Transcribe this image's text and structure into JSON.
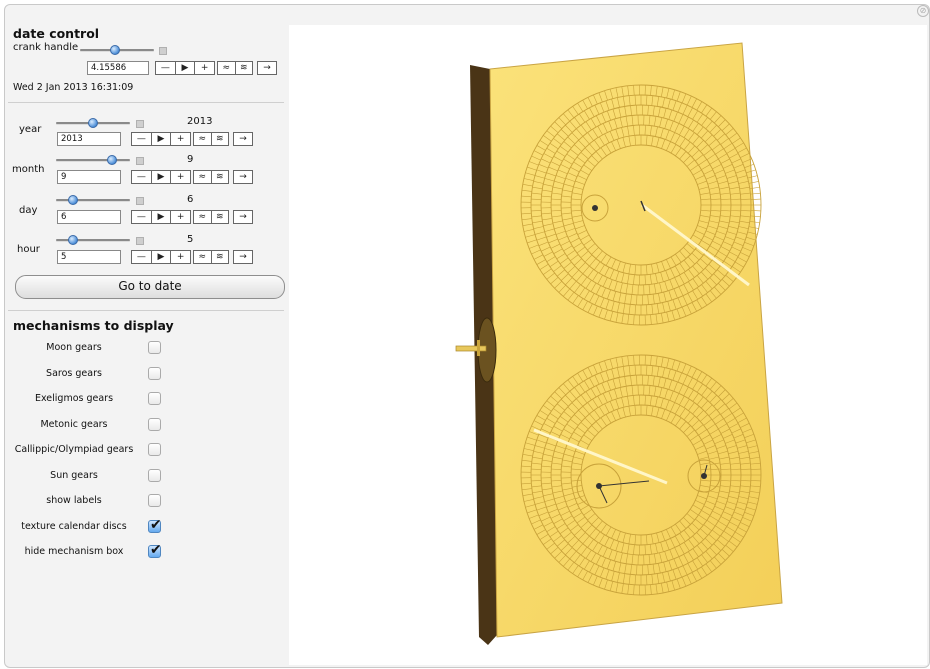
{
  "corner_icon": "close-icon",
  "date_control": {
    "title": "date control",
    "crank_label": "crank handle",
    "crank_value": "4.15586",
    "crank_slider_fraction": 0.45,
    "datetime_text": "Wed 2 Jan 2013 16:31:09",
    "play_buttons": [
      "—",
      "▶",
      "+",
      "≈",
      "≋",
      "→"
    ]
  },
  "params": [
    {
      "label": "year",
      "value": "2013",
      "display": "2013",
      "slider_fraction": 0.5
    },
    {
      "label": "month",
      "value": "9",
      "display": "9",
      "slider_fraction": 0.72
    },
    {
      "label": "day",
      "value": "6",
      "display": "6",
      "slider_fraction": 0.2
    },
    {
      "label": "hour",
      "value": "5",
      "display": "5",
      "slider_fraction": 0.2
    }
  ],
  "goto_label": "Go to date",
  "mechanisms": {
    "title": "mechanisms to display",
    "items": [
      {
        "label": "Moon gears",
        "checked": false
      },
      {
        "label": "Saros gears",
        "checked": false
      },
      {
        "label": "Exeligmos gears",
        "checked": false
      },
      {
        "label": "Metonic gears",
        "checked": false
      },
      {
        "label": "Callippic/Olympiad gears",
        "checked": false
      },
      {
        "label": "Sun gears",
        "checked": false
      },
      {
        "label": "show labels",
        "checked": false
      },
      {
        "label": "texture calendar discs",
        "checked": true
      },
      {
        "label": "hide mechanism box",
        "checked": true
      }
    ]
  },
  "colors": {
    "box_face": "#f8d868",
    "box_side": "#4a3416",
    "ring_line": "#c8a23a",
    "slider_thumb": "#4e8fd8"
  }
}
